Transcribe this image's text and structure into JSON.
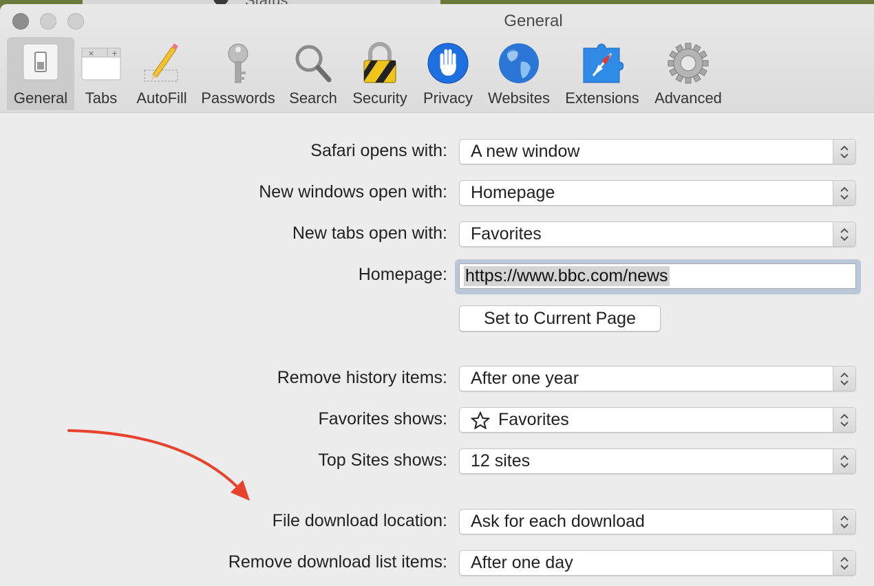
{
  "background_window": {
    "status_text": "Status"
  },
  "window": {
    "title": "General"
  },
  "toolbar": {
    "tabs": [
      {
        "label": "General",
        "icon": "switch-icon",
        "selected": true
      },
      {
        "label": "Tabs",
        "icon": "tabs-icon"
      },
      {
        "label": "AutoFill",
        "icon": "pencil-icon"
      },
      {
        "label": "Passwords",
        "icon": "key-icon"
      },
      {
        "label": "Search",
        "icon": "magnifier-icon"
      },
      {
        "label": "Security",
        "icon": "padlock-icon"
      },
      {
        "label": "Privacy",
        "icon": "hand-icon"
      },
      {
        "label": "Websites",
        "icon": "globe-icon"
      },
      {
        "label": "Extensions",
        "icon": "puzzle-compass-icon"
      },
      {
        "label": "Advanced",
        "icon": "gear-icon"
      }
    ]
  },
  "settings": {
    "safari_opens_with": {
      "label": "Safari opens with:",
      "value": "A new window"
    },
    "new_windows_open_with": {
      "label": "New windows open with:",
      "value": "Homepage"
    },
    "new_tabs_open_with": {
      "label": "New tabs open with:",
      "value": "Favorites"
    },
    "homepage": {
      "label": "Homepage:",
      "value": "https://www.bbc.com/news"
    },
    "set_current_page_label": "Set to Current Page",
    "remove_history_items": {
      "label": "Remove history items:",
      "value": "After one year"
    },
    "favorites_shows": {
      "label": "Favorites shows:",
      "value": "Favorites",
      "icon": "star-outline-icon"
    },
    "top_sites_shows": {
      "label": "Top Sites shows:",
      "value": "12 sites"
    },
    "file_download_location": {
      "label": "File download location:",
      "value": "Ask for each download"
    },
    "remove_download_list_items": {
      "label": "Remove download list items:",
      "value": "After one day"
    }
  },
  "annotation": {
    "arrow_color": "#e8412c"
  }
}
